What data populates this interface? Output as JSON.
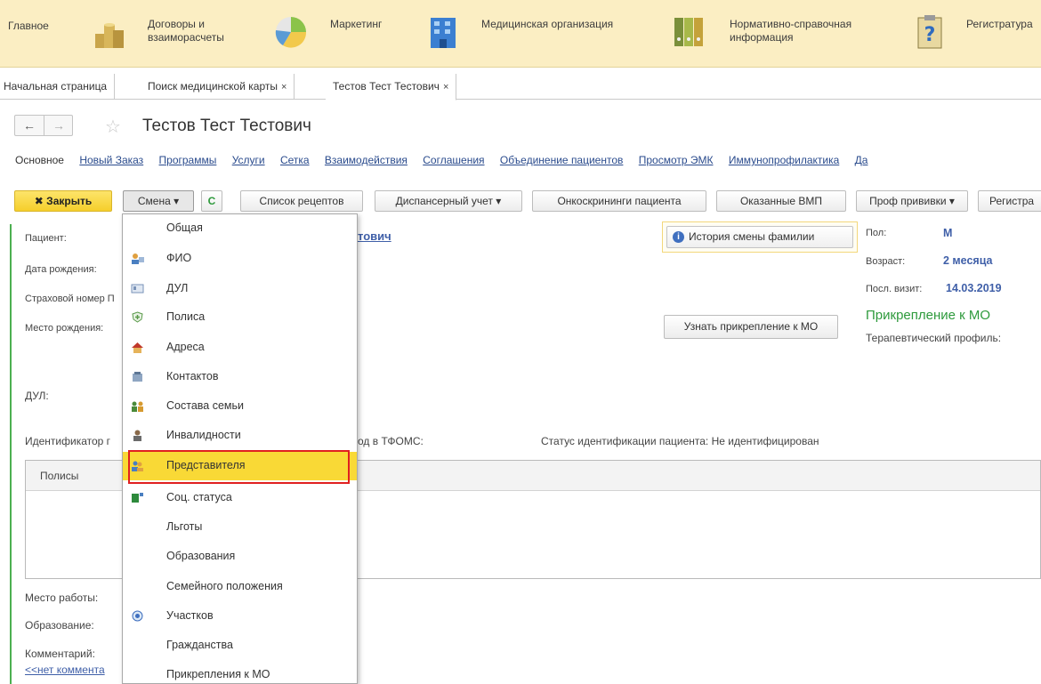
{
  "sections": [
    {
      "label": "Главное",
      "icon": "home-icon"
    },
    {
      "label": "Договоры и\nвзаиморасчеты",
      "icon": "coins-icon"
    },
    {
      "label": "Маркетинг",
      "icon": "pie-chart-icon"
    },
    {
      "label": "Медицинская организация",
      "icon": "building-icon"
    },
    {
      "label": "Нормативно-справочная\nинформация",
      "icon": "binders-icon"
    },
    {
      "label": "Регистратура",
      "icon": "clipboard-question-icon"
    }
  ],
  "tabs": [
    {
      "label": "Начальная страница"
    },
    {
      "label": "Поиск медицинской карты",
      "close": "×"
    },
    {
      "label": "Тестов Тест Тестович",
      "close": "×"
    }
  ],
  "header": {
    "title": "Тестов Тест Тестович",
    "back": "←",
    "forward": "→",
    "star": "☆"
  },
  "links": [
    "Основное",
    "Новый Заказ",
    "Программы",
    "Услуги",
    "Сетка",
    "Взаимодействия",
    "Соглашения",
    "Объединение пациентов",
    "Просмотр ЭМК",
    "Иммунопрофилактика",
    "Да"
  ],
  "toolbar": {
    "close": "✖ Закрыть",
    "change": "Смена",
    "refresh": "C",
    "recipes": "Список рецептов",
    "dispensary": "Диспансерный учет",
    "oncoscreen": "Онкоскрининги пациента",
    "vmp": "Оказанные ВМП",
    "vaccines": "Проф прививки",
    "register": "Регистра",
    "dropdown_arrow": "▾"
  },
  "form": {
    "patient_label": "Пациент:",
    "patient_value": "тович",
    "birth_label": "Дата рождения:",
    "insurance_label": "Страховой номер П",
    "birthplace_label": "Место рождения:",
    "dul_label": "ДУЛ:",
    "identifier_label": "Идентификатор г",
    "tfoms_label": "од в ТФОМС:",
    "ident_status": "Статус идентификации пациента: Не идентифицирован",
    "history_button": "История смены фамилии",
    "attach_button": "Узнать прикрепление к МО",
    "sex_label": "Пол:",
    "sex_value": "М",
    "age_label": "Возраст:",
    "age_value": "2 месяца",
    "visit_label": "Посл. визит:",
    "visit_value": "14.03.2019",
    "attach_title": "Прикрепление к МО",
    "therapy_label": "Терапевтический профиль:",
    "policies_header": "Полисы",
    "work_label": "Место работы:",
    "education_label": "Образование:",
    "comment_label": "Комментарий:",
    "comment_link": "<<нет коммента"
  },
  "menu": [
    {
      "label": "Общая",
      "icon": ""
    },
    {
      "label": "ФИО",
      "icon": "person-card-icon"
    },
    {
      "label": "ДУЛ",
      "icon": "id-card-icon"
    },
    {
      "label": "Полиса",
      "icon": "shield-plus-icon"
    },
    {
      "label": "Адреса",
      "icon": "house-icon"
    },
    {
      "label": "Контактов",
      "icon": "phone-icon"
    },
    {
      "label": "Состава семьи",
      "icon": "family-icon"
    },
    {
      "label": "Инвалидности",
      "icon": "person-icon"
    },
    {
      "label": "Представителя",
      "icon": "representative-icon"
    },
    {
      "label": "Соц. статуса",
      "icon": "social-status-icon"
    },
    {
      "label": "Льготы",
      "icon": ""
    },
    {
      "label": "Образования",
      "icon": ""
    },
    {
      "label": "Семейного положения",
      "icon": ""
    },
    {
      "label": "Участков",
      "icon": "district-icon"
    },
    {
      "label": "Гражданства",
      "icon": ""
    },
    {
      "label": "Прикрепления к МО",
      "icon": ""
    }
  ],
  "colors": {
    "accent_yellow": "#f9d936",
    "link": "#3f5fa8",
    "green": "#2e9a3c",
    "highlight_border": "#e02020"
  }
}
